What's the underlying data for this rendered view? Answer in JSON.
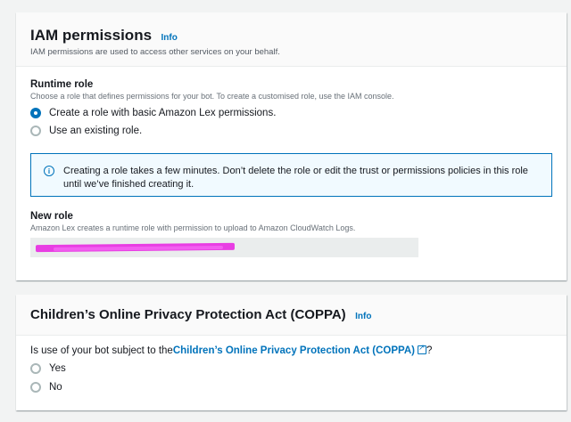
{
  "iam": {
    "title": "IAM permissions",
    "info_label": "Info",
    "description": "IAM permissions are used to access other services on your behalf.",
    "runtime_role": {
      "label": "Runtime role",
      "description": "Choose a role that defines permissions for your bot. To create a customised role, use the IAM console.",
      "options": [
        {
          "label": "Create a role with basic Amazon Lex permissions.",
          "checked": true
        },
        {
          "label": "Use an existing role.",
          "checked": false
        }
      ]
    },
    "alert": {
      "icon": "info-icon",
      "text": "Creating a role takes a few minutes. Don’t delete the role or edit the trust or permissions policies in this role until we’ve finished creating it."
    },
    "new_role": {
      "label": "New role",
      "description": "Amazon Lex creates a runtime role with permission to upload to Amazon CloudWatch Logs."
    }
  },
  "coppa": {
    "title": "Children’s Online Privacy Protection Act (COPPA)",
    "info_label": "Info",
    "question_prefix": "Is use of your bot subject to the",
    "question_link": "Children’s Online Privacy Protection Act (COPPA)",
    "question_suffix": "?",
    "options": [
      {
        "label": "Yes",
        "checked": false
      },
      {
        "label": "No",
        "checked": false
      }
    ]
  },
  "colors": {
    "accent": "#0073bb",
    "redaction": "#e83ee3"
  }
}
